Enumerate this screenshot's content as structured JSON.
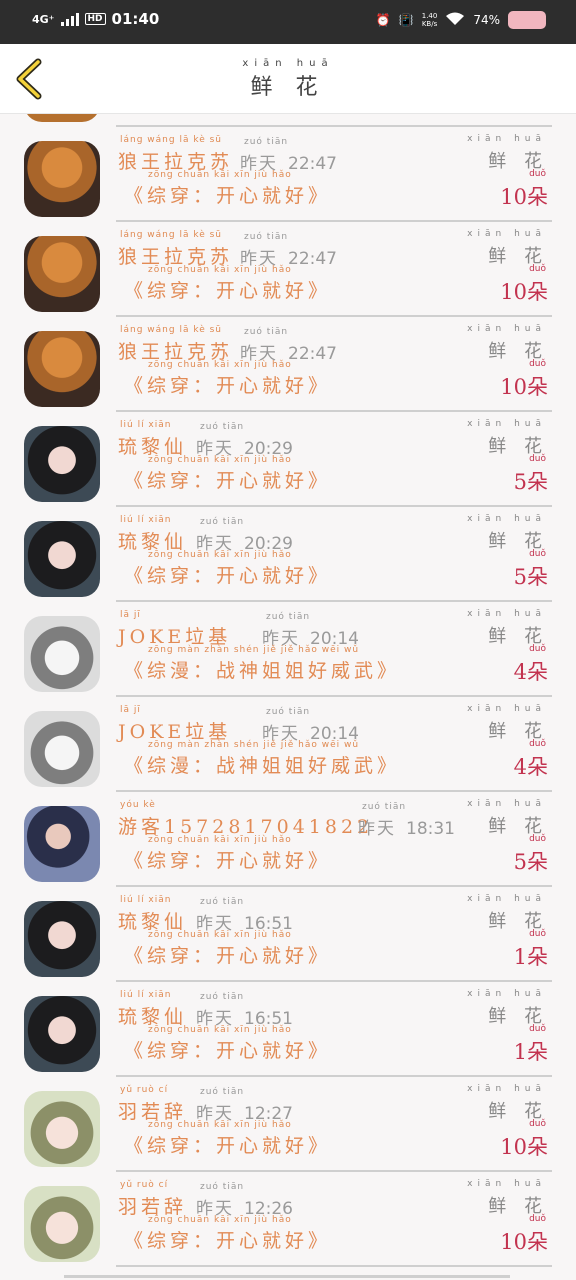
{
  "status_bar": {
    "network": "4G⁺",
    "hd": "HD",
    "time": "01:40",
    "speed_value": "1.40",
    "speed_unit": "KB/s",
    "battery": "74%"
  },
  "header": {
    "title": "鲜 花",
    "title_pinyin": "xiān huā",
    "back_icon": "back-chevron-icon"
  },
  "gift_label": "鲜 花",
  "gift_pinyin": "xiān huā",
  "unit": "朵",
  "unit_pinyin": "duǒ",
  "rows": [
    {
      "name": "狼王拉克苏",
      "name_pinyin": "láng wáng lā kè sū",
      "time": "22:47",
      "day": "昨天",
      "day_pinyin": "zuó tiān",
      "message": "《综穿：开心就好》",
      "message_pinyin": "zōng chuān   kāi  xīn  jiù  hǎo",
      "count": "10",
      "avatar": "orange-cat"
    },
    {
      "name": "狼王拉克苏",
      "name_pinyin": "láng wáng lā kè sū",
      "time": "22:47",
      "day": "昨天",
      "day_pinyin": "zuó tiān",
      "message": "《综穿：开心就好》",
      "message_pinyin": "zōng chuān   kāi  xīn  jiù  hǎo",
      "count": "10",
      "avatar": "orange-cat"
    },
    {
      "name": "狼王拉克苏",
      "name_pinyin": "láng wáng lā kè sū",
      "time": "22:47",
      "day": "昨天",
      "day_pinyin": "zuó tiān",
      "message": "《综穿：开心就好》",
      "message_pinyin": "zōng chuān   kāi  xīn  jiù  hǎo",
      "count": "10",
      "avatar": "orange-cat"
    },
    {
      "name": "琉黎仙",
      "name_pinyin": "liú lí xiān",
      "time": "20:29",
      "day": "昨天",
      "day_pinyin": "zuó tiān",
      "message": "《综穿：开心就好》",
      "message_pinyin": "zōng chuān   kāi  xīn  jiù  hǎo",
      "count": "5",
      "avatar": "girl-dark"
    },
    {
      "name": "琉黎仙",
      "name_pinyin": "liú lí xiān",
      "time": "20:29",
      "day": "昨天",
      "day_pinyin": "zuó tiān",
      "message": "《综穿：开心就好》",
      "message_pinyin": "zōng chuān   kāi  xīn  jiù  hǎo",
      "count": "5",
      "avatar": "girl-dark"
    },
    {
      "name": "JOKE垃基",
      "name_pinyin": "lā jī",
      "time": "20:14",
      "day": "昨天",
      "day_pinyin": "zuó tiān",
      "message": "《综漫：战神姐姐好威武》",
      "message_pinyin": "zōng màn   zhàn shén jiě jiě hǎo wēi wǔ",
      "count": "4",
      "avatar": "anime-boy"
    },
    {
      "name": "JOKE垃基",
      "name_pinyin": "lā jī",
      "time": "20:14",
      "day": "昨天",
      "day_pinyin": "zuó tiān",
      "message": "《综漫：战神姐姐好威武》",
      "message_pinyin": "zōng màn   zhàn shén jiě jiě hǎo wēi wǔ",
      "count": "4",
      "avatar": "anime-boy"
    },
    {
      "name": "游客15728170418​22",
      "name_pinyin": "yóu kè",
      "time": "18:31",
      "day": "昨天",
      "day_pinyin": "zuó tiān",
      "message": "《综穿：开心就好》",
      "message_pinyin": "zōng chuān   kāi  xīn  jiù  hǎo",
      "count": "5",
      "avatar": "girl-blue"
    },
    {
      "name": "琉黎仙",
      "name_pinyin": "liú lí xiān",
      "time": "16:51",
      "day": "昨天",
      "day_pinyin": "zuó tiān",
      "message": "《综穿：开心就好》",
      "message_pinyin": "zōng chuān   kāi  xīn  jiù  hǎo",
      "count": "1",
      "avatar": "girl-dark"
    },
    {
      "name": "琉黎仙",
      "name_pinyin": "liú lí xiān",
      "time": "16:51",
      "day": "昨天",
      "day_pinyin": "zuó tiān",
      "message": "《综穿：开心就好》",
      "message_pinyin": "zōng chuān   kāi  xīn  jiù  hǎo",
      "count": "1",
      "avatar": "girl-dark"
    },
    {
      "name": "羽若辞",
      "name_pinyin": "yǔ ruò cí",
      "time": "12:27",
      "day": "昨天",
      "day_pinyin": "zuó tiān",
      "message": "《综穿：开心就好》",
      "message_pinyin": "zōng chuān   kāi  xīn  jiù  hǎo",
      "count": "10",
      "avatar": "anime-kid"
    },
    {
      "name": "羽若辞",
      "name_pinyin": "yǔ ruò cí",
      "time": "12:26",
      "day": "昨天",
      "day_pinyin": "zuó tiān",
      "message": "《综穿：开心就好》",
      "message_pinyin": "zōng chuān   kāi  xīn  jiù  hǎo",
      "count": "10",
      "avatar": "anime-kid"
    }
  ]
}
